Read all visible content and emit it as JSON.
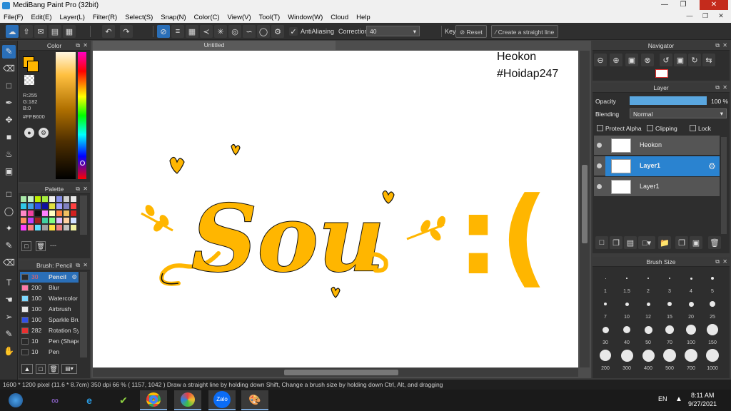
{
  "window": {
    "title": "MediBang Paint Pro (32bit)"
  },
  "menu": [
    "File(F)",
    "Edit(E)",
    "Layer(L)",
    "Filter(R)",
    "Select(S)",
    "Snap(N)",
    "Color(C)",
    "View(V)",
    "Tool(T)",
    "Window(W)",
    "Cloud",
    "Help"
  ],
  "toolbar": {
    "antialiasing_label": "AntiAliasing",
    "correction_label": "Correction",
    "correction_value": "40",
    "key_label": "Key",
    "reset_label": "Reset",
    "straight_line_label": "Create a straight line"
  },
  "color_panel": {
    "title": "Color",
    "r": "R:255",
    "g": "G:182",
    "b": "B:0",
    "hex": "#FFB600",
    "primary_color": "#FFB600"
  },
  "palette_panel": {
    "title": "Palette",
    "dash": "---",
    "colors": [
      "#a8e8a8",
      "#c8f0c8",
      "#c0f000",
      "#a8f040",
      "#f0f0f0",
      "#8890e8",
      "#d0d0d0",
      "#e8e8e8",
      "#30c8e8",
      "#40a0e8",
      "#3050e8",
      "#1010a0",
      "#e0e040",
      "#a0a0ff",
      "#8080c0",
      "#ff4040",
      "#ff88c8",
      "#f040a0",
      "#101010",
      "#ff80ff",
      "#ffffc0",
      "#ff8040",
      "#f0c060",
      "#d02020",
      "#ff9060",
      "#c040ff",
      "#a02020",
      "#40d0a0",
      "#80ff80",
      "#e0c0ff",
      "#ffd0a0",
      "#d0e0ff",
      "#ff40ff",
      "#ff8080",
      "#60e0ff",
      "#a0a0a0",
      "#ffe040",
      "#f08080",
      "#c0c0c0",
      "#f0f0a0"
    ]
  },
  "brush_panel": {
    "title": "Brush: Pencil",
    "brushes": [
      {
        "size": "30",
        "name": "Pencil",
        "color": "#2a2a2a"
      },
      {
        "size": "200",
        "name": "Blur",
        "color": "#ff7aa8"
      },
      {
        "size": "100",
        "name": "Watercolor",
        "color": "#7fd8ff"
      },
      {
        "size": "100",
        "name": "Airbrush",
        "color": "#e8e8e8"
      },
      {
        "size": "100",
        "name": "Sparkle Brush",
        "color": "#3050e8"
      },
      {
        "size": "282",
        "name": "Rotation Symmetry",
        "color": "#e83030"
      },
      {
        "size": "10",
        "name": "Pen (Shape)",
        "color": "#2a2a2a"
      },
      {
        "size": "10",
        "name": "Pen",
        "color": "#2a2a2a"
      }
    ]
  },
  "canvas": {
    "tab_title": "Untitled",
    "watermark_line1": "Heokon",
    "watermark_line2": "#Hoidap247",
    "drawing_text": "Sou",
    "drawing_emote": ":(",
    "ink_color": "#FFB600"
  },
  "navigator": {
    "title": "Navigator"
  },
  "layer_panel": {
    "title": "Layer",
    "opacity_label": "Opacity",
    "opacity_value": "100 %",
    "opacity_fraction": 1.0,
    "blending_label": "Blending",
    "blending_value": "Normal",
    "protect_alpha_label": "Protect Alpha",
    "clipping_label": "Clipping",
    "lock_label": "Lock",
    "layers": [
      {
        "name": "Heokon"
      },
      {
        "name": "Layer1"
      },
      {
        "name": "Layer1"
      }
    ]
  },
  "brush_size_panel": {
    "title": "Brush Size",
    "sizes": [
      "1",
      "1.5",
      "2",
      "3",
      "4",
      "5",
      "7",
      "10",
      "12",
      "15",
      "20",
      "25",
      "30",
      "40",
      "50",
      "70",
      "100",
      "150",
      "200",
      "300",
      "400",
      "500",
      "700",
      "1000"
    ]
  },
  "statusbar": {
    "canvas_size": "1600 * 1200 pixel",
    "physical_size": "(11.6 * 8.7cm)",
    "dpi": "350 dpi",
    "zoom": "66 %",
    "coords": "( 1157, 1042 )",
    "hint": "Draw a straight line by holding down Shift, Change a brush size by holding down Ctrl, Alt, and dragging"
  },
  "taskbar": {
    "zalo_label": "Zalo",
    "language": "EN",
    "time": "8:11 AM",
    "date": "9/27/2021"
  }
}
